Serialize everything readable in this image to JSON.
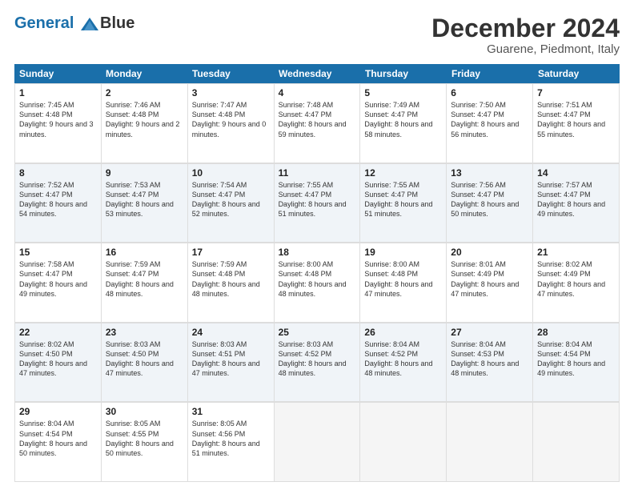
{
  "header": {
    "logo_line1": "General",
    "logo_line2": "Blue",
    "title": "December 2024",
    "subtitle": "Guarene, Piedmont, Italy"
  },
  "calendar": {
    "days_of_week": [
      "Sunday",
      "Monday",
      "Tuesday",
      "Wednesday",
      "Thursday",
      "Friday",
      "Saturday"
    ],
    "weeks": [
      [
        {
          "day": "1",
          "sunrise": "7:45 AM",
          "sunset": "4:48 PM",
          "daylight": "9 hours and 3 minutes."
        },
        {
          "day": "2",
          "sunrise": "7:46 AM",
          "sunset": "4:48 PM",
          "daylight": "9 hours and 2 minutes."
        },
        {
          "day": "3",
          "sunrise": "7:47 AM",
          "sunset": "4:48 PM",
          "daylight": "9 hours and 0 minutes."
        },
        {
          "day": "4",
          "sunrise": "7:48 AM",
          "sunset": "4:47 PM",
          "daylight": "8 hours and 59 minutes."
        },
        {
          "day": "5",
          "sunrise": "7:49 AM",
          "sunset": "4:47 PM",
          "daylight": "8 hours and 58 minutes."
        },
        {
          "day": "6",
          "sunrise": "7:50 AM",
          "sunset": "4:47 PM",
          "daylight": "8 hours and 56 minutes."
        },
        {
          "day": "7",
          "sunrise": "7:51 AM",
          "sunset": "4:47 PM",
          "daylight": "8 hours and 55 minutes."
        }
      ],
      [
        {
          "day": "8",
          "sunrise": "7:52 AM",
          "sunset": "4:47 PM",
          "daylight": "8 hours and 54 minutes."
        },
        {
          "day": "9",
          "sunrise": "7:53 AM",
          "sunset": "4:47 PM",
          "daylight": "8 hours and 53 minutes."
        },
        {
          "day": "10",
          "sunrise": "7:54 AM",
          "sunset": "4:47 PM",
          "daylight": "8 hours and 52 minutes."
        },
        {
          "day": "11",
          "sunrise": "7:55 AM",
          "sunset": "4:47 PM",
          "daylight": "8 hours and 51 minutes."
        },
        {
          "day": "12",
          "sunrise": "7:55 AM",
          "sunset": "4:47 PM",
          "daylight": "8 hours and 51 minutes."
        },
        {
          "day": "13",
          "sunrise": "7:56 AM",
          "sunset": "4:47 PM",
          "daylight": "8 hours and 50 minutes."
        },
        {
          "day": "14",
          "sunrise": "7:57 AM",
          "sunset": "4:47 PM",
          "daylight": "8 hours and 49 minutes."
        }
      ],
      [
        {
          "day": "15",
          "sunrise": "7:58 AM",
          "sunset": "4:47 PM",
          "daylight": "8 hours and 49 minutes."
        },
        {
          "day": "16",
          "sunrise": "7:59 AM",
          "sunset": "4:47 PM",
          "daylight": "8 hours and 48 minutes."
        },
        {
          "day": "17",
          "sunrise": "7:59 AM",
          "sunset": "4:48 PM",
          "daylight": "8 hours and 48 minutes."
        },
        {
          "day": "18",
          "sunrise": "8:00 AM",
          "sunset": "4:48 PM",
          "daylight": "8 hours and 48 minutes."
        },
        {
          "day": "19",
          "sunrise": "8:00 AM",
          "sunset": "4:48 PM",
          "daylight": "8 hours and 47 minutes."
        },
        {
          "day": "20",
          "sunrise": "8:01 AM",
          "sunset": "4:49 PM",
          "daylight": "8 hours and 47 minutes."
        },
        {
          "day": "21",
          "sunrise": "8:02 AM",
          "sunset": "4:49 PM",
          "daylight": "8 hours and 47 minutes."
        }
      ],
      [
        {
          "day": "22",
          "sunrise": "8:02 AM",
          "sunset": "4:50 PM",
          "daylight": "8 hours and 47 minutes."
        },
        {
          "day": "23",
          "sunrise": "8:03 AM",
          "sunset": "4:50 PM",
          "daylight": "8 hours and 47 minutes."
        },
        {
          "day": "24",
          "sunrise": "8:03 AM",
          "sunset": "4:51 PM",
          "daylight": "8 hours and 47 minutes."
        },
        {
          "day": "25",
          "sunrise": "8:03 AM",
          "sunset": "4:52 PM",
          "daylight": "8 hours and 48 minutes."
        },
        {
          "day": "26",
          "sunrise": "8:04 AM",
          "sunset": "4:52 PM",
          "daylight": "8 hours and 48 minutes."
        },
        {
          "day": "27",
          "sunrise": "8:04 AM",
          "sunset": "4:53 PM",
          "daylight": "8 hours and 48 minutes."
        },
        {
          "day": "28",
          "sunrise": "8:04 AM",
          "sunset": "4:54 PM",
          "daylight": "8 hours and 49 minutes."
        }
      ],
      [
        {
          "day": "29",
          "sunrise": "8:04 AM",
          "sunset": "4:54 PM",
          "daylight": "8 hours and 50 minutes."
        },
        {
          "day": "30",
          "sunrise": "8:05 AM",
          "sunset": "4:55 PM",
          "daylight": "8 hours and 50 minutes."
        },
        {
          "day": "31",
          "sunrise": "8:05 AM",
          "sunset": "4:56 PM",
          "daylight": "8 hours and 51 minutes."
        },
        null,
        null,
        null,
        null
      ]
    ]
  }
}
